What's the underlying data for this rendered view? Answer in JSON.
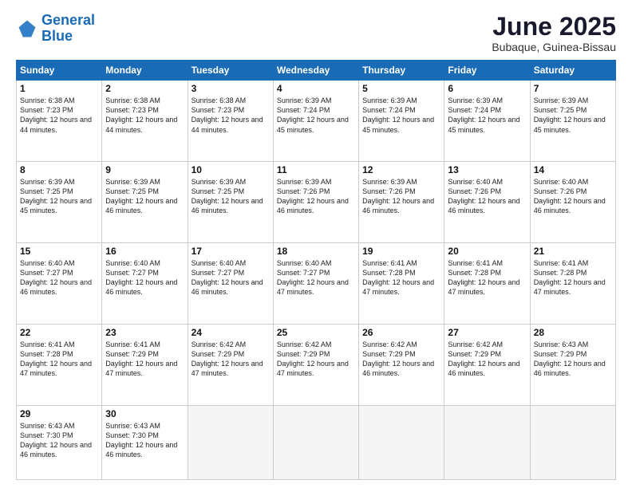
{
  "header": {
    "logo_line1": "General",
    "logo_line2": "Blue",
    "month": "June 2025",
    "location": "Bubaque, Guinea-Bissau"
  },
  "days_of_week": [
    "Sunday",
    "Monday",
    "Tuesday",
    "Wednesday",
    "Thursday",
    "Friday",
    "Saturday"
  ],
  "weeks": [
    [
      {
        "num": "1",
        "sunrise": "6:38 AM",
        "sunset": "7:23 PM",
        "daylight": "12 hours and 44 minutes."
      },
      {
        "num": "2",
        "sunrise": "6:38 AM",
        "sunset": "7:23 PM",
        "daylight": "12 hours and 44 minutes."
      },
      {
        "num": "3",
        "sunrise": "6:38 AM",
        "sunset": "7:23 PM",
        "daylight": "12 hours and 44 minutes."
      },
      {
        "num": "4",
        "sunrise": "6:39 AM",
        "sunset": "7:24 PM",
        "daylight": "12 hours and 45 minutes."
      },
      {
        "num": "5",
        "sunrise": "6:39 AM",
        "sunset": "7:24 PM",
        "daylight": "12 hours and 45 minutes."
      },
      {
        "num": "6",
        "sunrise": "6:39 AM",
        "sunset": "7:24 PM",
        "daylight": "12 hours and 45 minutes."
      },
      {
        "num": "7",
        "sunrise": "6:39 AM",
        "sunset": "7:25 PM",
        "daylight": "12 hours and 45 minutes."
      }
    ],
    [
      {
        "num": "8",
        "sunrise": "6:39 AM",
        "sunset": "7:25 PM",
        "daylight": "12 hours and 45 minutes."
      },
      {
        "num": "9",
        "sunrise": "6:39 AM",
        "sunset": "7:25 PM",
        "daylight": "12 hours and 46 minutes."
      },
      {
        "num": "10",
        "sunrise": "6:39 AM",
        "sunset": "7:25 PM",
        "daylight": "12 hours and 46 minutes."
      },
      {
        "num": "11",
        "sunrise": "6:39 AM",
        "sunset": "7:26 PM",
        "daylight": "12 hours and 46 minutes."
      },
      {
        "num": "12",
        "sunrise": "6:39 AM",
        "sunset": "7:26 PM",
        "daylight": "12 hours and 46 minutes."
      },
      {
        "num": "13",
        "sunrise": "6:40 AM",
        "sunset": "7:26 PM",
        "daylight": "12 hours and 46 minutes."
      },
      {
        "num": "14",
        "sunrise": "6:40 AM",
        "sunset": "7:26 PM",
        "daylight": "12 hours and 46 minutes."
      }
    ],
    [
      {
        "num": "15",
        "sunrise": "6:40 AM",
        "sunset": "7:27 PM",
        "daylight": "12 hours and 46 minutes."
      },
      {
        "num": "16",
        "sunrise": "6:40 AM",
        "sunset": "7:27 PM",
        "daylight": "12 hours and 46 minutes."
      },
      {
        "num": "17",
        "sunrise": "6:40 AM",
        "sunset": "7:27 PM",
        "daylight": "12 hours and 46 minutes."
      },
      {
        "num": "18",
        "sunrise": "6:40 AM",
        "sunset": "7:27 PM",
        "daylight": "12 hours and 47 minutes."
      },
      {
        "num": "19",
        "sunrise": "6:41 AM",
        "sunset": "7:28 PM",
        "daylight": "12 hours and 47 minutes."
      },
      {
        "num": "20",
        "sunrise": "6:41 AM",
        "sunset": "7:28 PM",
        "daylight": "12 hours and 47 minutes."
      },
      {
        "num": "21",
        "sunrise": "6:41 AM",
        "sunset": "7:28 PM",
        "daylight": "12 hours and 47 minutes."
      }
    ],
    [
      {
        "num": "22",
        "sunrise": "6:41 AM",
        "sunset": "7:28 PM",
        "daylight": "12 hours and 47 minutes."
      },
      {
        "num": "23",
        "sunrise": "6:41 AM",
        "sunset": "7:29 PM",
        "daylight": "12 hours and 47 minutes."
      },
      {
        "num": "24",
        "sunrise": "6:42 AM",
        "sunset": "7:29 PM",
        "daylight": "12 hours and 47 minutes."
      },
      {
        "num": "25",
        "sunrise": "6:42 AM",
        "sunset": "7:29 PM",
        "daylight": "12 hours and 47 minutes."
      },
      {
        "num": "26",
        "sunrise": "6:42 AM",
        "sunset": "7:29 PM",
        "daylight": "12 hours and 46 minutes."
      },
      {
        "num": "27",
        "sunrise": "6:42 AM",
        "sunset": "7:29 PM",
        "daylight": "12 hours and 46 minutes."
      },
      {
        "num": "28",
        "sunrise": "6:43 AM",
        "sunset": "7:29 PM",
        "daylight": "12 hours and 46 minutes."
      }
    ],
    [
      {
        "num": "29",
        "sunrise": "6:43 AM",
        "sunset": "7:30 PM",
        "daylight": "12 hours and 46 minutes."
      },
      {
        "num": "30",
        "sunrise": "6:43 AM",
        "sunset": "7:30 PM",
        "daylight": "12 hours and 46 minutes."
      },
      null,
      null,
      null,
      null,
      null
    ]
  ]
}
